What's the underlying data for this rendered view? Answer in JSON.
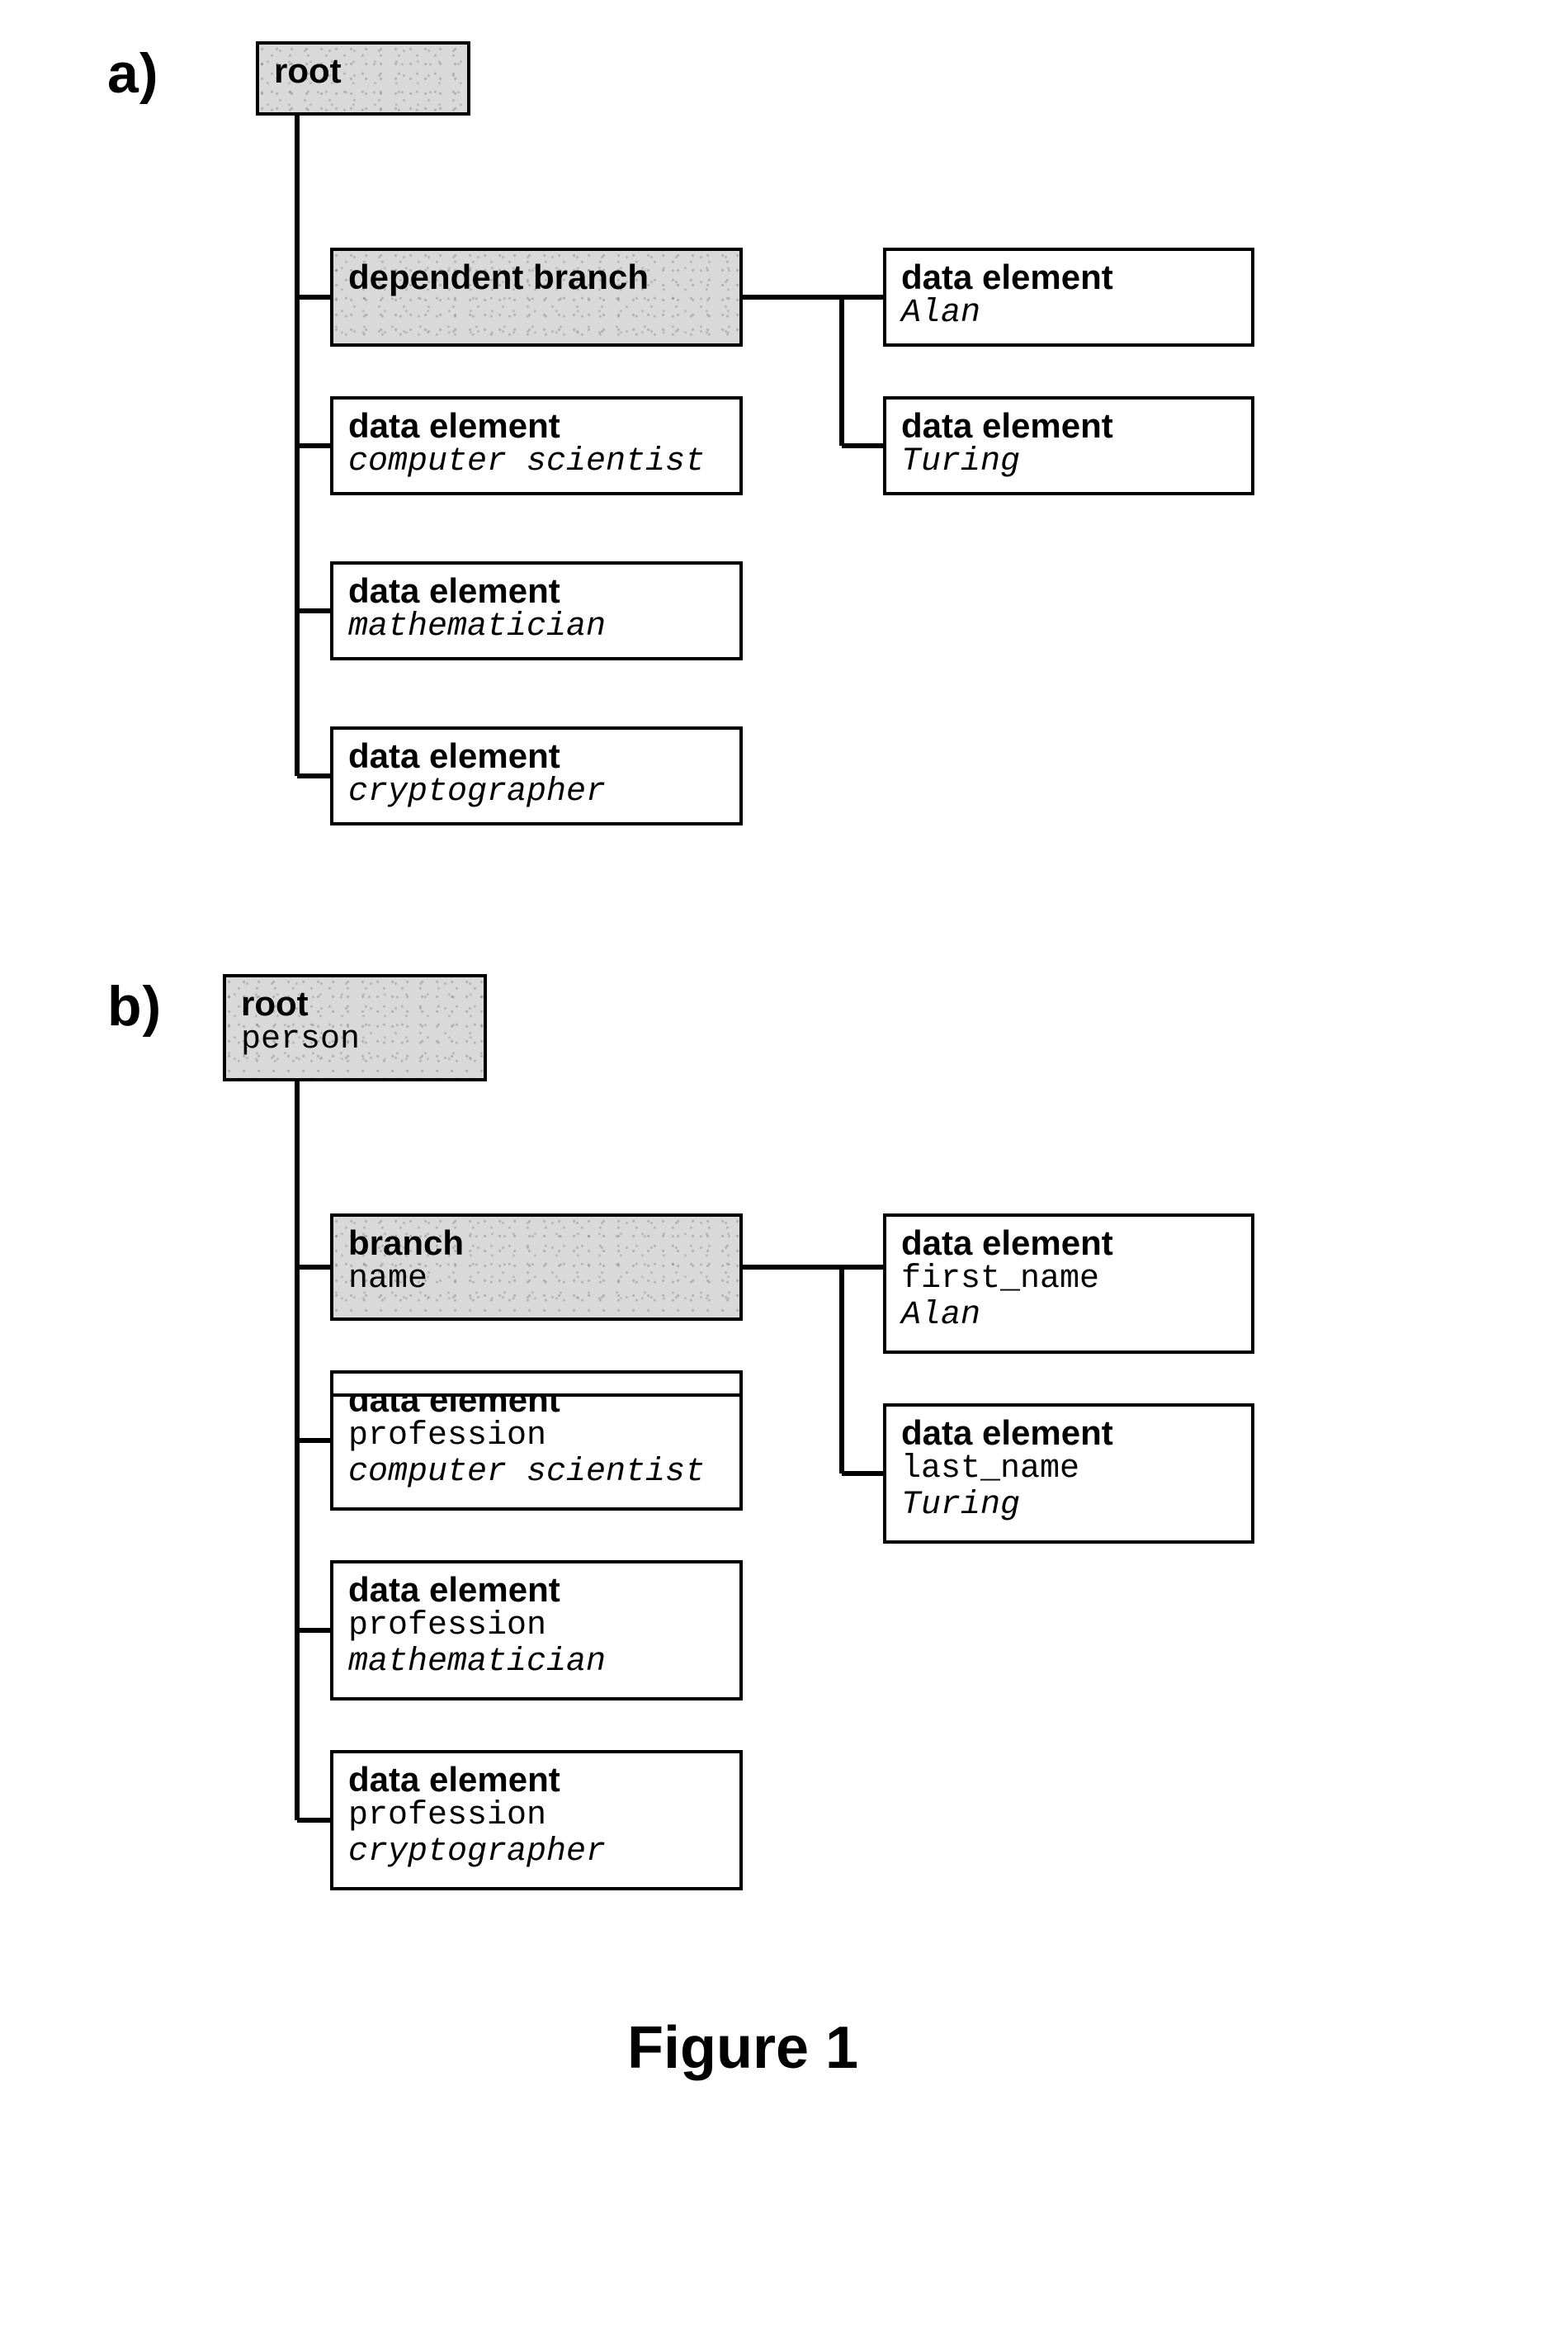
{
  "figure_label": "Figure 1",
  "partA": {
    "letter": "a)",
    "root": {
      "title": "root"
    },
    "left": [
      {
        "title": "dependent branch"
      },
      {
        "title": "data element",
        "value": "computer scientist"
      },
      {
        "title": "data element",
        "value": "mathematician"
      },
      {
        "title": "data element",
        "value": "cryptographer"
      }
    ],
    "right": [
      {
        "title": "data element",
        "value": "Alan"
      },
      {
        "title": "data element",
        "value": "Turing"
      }
    ]
  },
  "partB": {
    "letter": "b)",
    "root": {
      "title": "root",
      "subtitle": "person"
    },
    "left": [
      {
        "title": "branch",
        "subtitle": "name"
      },
      {
        "title": "data element",
        "subtitle": "profession",
        "value": "computer scientist"
      },
      {
        "title": "data element",
        "subtitle": "profession",
        "value": "mathematician"
      },
      {
        "title": "data element",
        "subtitle": "profession",
        "value": "cryptographer"
      }
    ],
    "right": [
      {
        "title": "data element",
        "subtitle": "first_name",
        "value": "Alan"
      },
      {
        "title": "data element",
        "subtitle": "last_name",
        "value": "Turing"
      }
    ]
  }
}
